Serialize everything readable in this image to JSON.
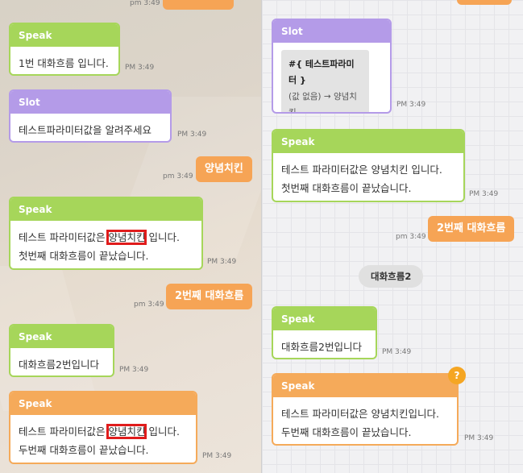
{
  "left": {
    "top_time": "pm 3:49",
    "messages": [
      {
        "type": "Speak",
        "text": "1번 대화흐름 입니다.",
        "time": "PM 3:49"
      },
      {
        "type": "Slot",
        "text": "테스트파라미터값을 알려주세요",
        "time": "PM 3:49"
      },
      {
        "user_text": "양념치킨",
        "user_time": "pm 3:49"
      },
      {
        "type": "Speak",
        "line1_pre": "테스트 파라미터값은 ",
        "line1_hl": "양념치킨",
        "line1_post": " 입니다.",
        "line2": "첫번째 대화흐름이 끝났습니다.",
        "time": "PM 3:49"
      },
      {
        "user_text": "2번째 대화흐름",
        "user_time": "pm 3:49"
      },
      {
        "type": "Speak",
        "text": "대화흐름2번입니다",
        "time": "PM 3:49"
      },
      {
        "type": "Speak",
        "line1_pre": "테스트 파라미터값은 ",
        "line1_hl": "양념치킨",
        "line1_post": " 입니다.",
        "line2": "두번째 대화흐름이 끝났습니다.",
        "time": "PM 3:49"
      }
    ]
  },
  "right": {
    "slot": {
      "type": "Slot",
      "param_name": "#{ 테스트파라미터 }",
      "param_value": "(값 없음) → 양념치킨",
      "time": "PM 3:49"
    },
    "speak1": {
      "type": "Speak",
      "line1": "테스트 파라미터값은 양념치킨 입니다.",
      "line2": "첫번째 대화흐름이 끝났습니다.",
      "time": "PM 3:49"
    },
    "user1": {
      "text": "2번째 대화흐름",
      "time": "pm 3:49"
    },
    "chip": "대화흐름2",
    "speak2": {
      "type": "Speak",
      "text": "대화흐름2번입니다",
      "time": "PM 3:49"
    },
    "speak3": {
      "type": "Speak",
      "line1": "테스트 파라미터값은 양념치킨입니다.",
      "line2": "두번째 대화흐름이 끝났습니다.",
      "time": "PM 3:49",
      "badge": "?"
    }
  },
  "colors": {
    "speak": "#a6d65a",
    "slot": "#b49be8",
    "orange": "#f5aa5a",
    "highlight": "#e01c1c"
  }
}
